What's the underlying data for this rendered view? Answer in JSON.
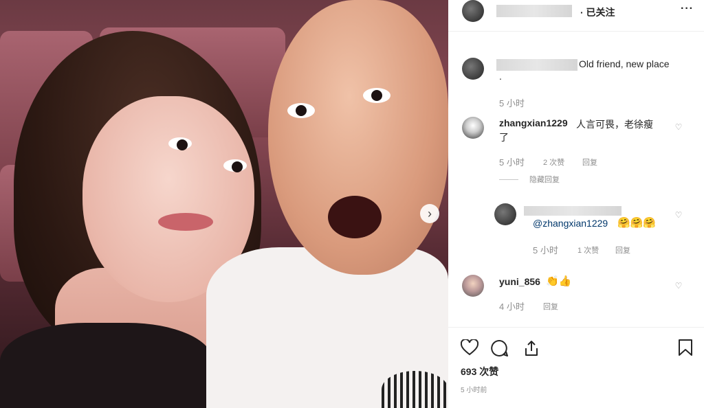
{
  "header": {
    "follow_status": "· 已关注",
    "more": "···"
  },
  "caption": {
    "text": "Old friend, new place",
    "dot": ".",
    "time": "5 小时"
  },
  "comments": [
    {
      "user": "zhangxian1229",
      "text_line1": "人言可畏，老徐瘦",
      "text_line2": "了",
      "time": "5 小时",
      "likes": "2 次赞",
      "reply": "回复",
      "hide_replies": "隐藏回复"
    },
    {
      "mention": "@zhangxian1229",
      "emoji": "🤗🤗🤗",
      "time": "5 小时",
      "likes": "1 次赞",
      "reply": "回复"
    },
    {
      "user": "yuni_856",
      "emoji": "👏👍",
      "time": "4 小时",
      "reply": "回复"
    }
  ],
  "actions": {
    "like_count": "693 次赞",
    "post_time": "5 小时前"
  }
}
